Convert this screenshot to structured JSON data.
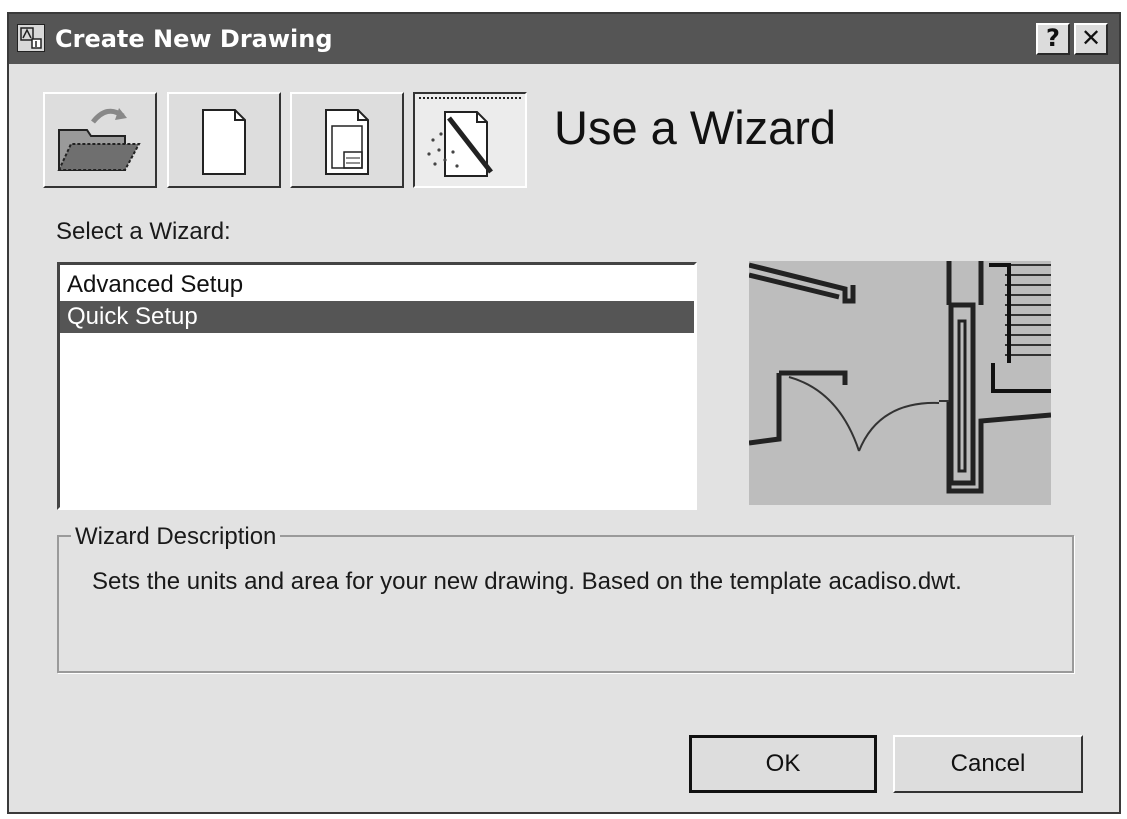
{
  "window": {
    "title": "Create New Drawing",
    "help_glyph": "?",
    "close_glyph": "✕",
    "app_icon": "autocad-drawing-icon"
  },
  "mode_buttons": [
    {
      "icon": "open-folder-icon",
      "state": "raised"
    },
    {
      "icon": "blank-page-icon",
      "state": "raised"
    },
    {
      "icon": "template-page-icon",
      "state": "raised"
    },
    {
      "icon": "wizard-wand-icon",
      "state": "pressed"
    }
  ],
  "mode_title": "Use a Wizard",
  "select_label": "Select a Wizard:",
  "wizards": [
    {
      "label": "Advanced Setup",
      "selected": false
    },
    {
      "label": "Quick Setup",
      "selected": true
    }
  ],
  "preview": {
    "icon": "floor-plan-preview-image"
  },
  "description": {
    "legend": "Wizard Description",
    "text": "Sets the units and area for your new drawing. Based on the template acadiso.dwt."
  },
  "buttons": {
    "ok": "OK",
    "cancel": "Cancel"
  },
  "colors": {
    "dialog_bg": "#e2e2e2",
    "titlebar": "#555555",
    "selection": "#555555"
  }
}
